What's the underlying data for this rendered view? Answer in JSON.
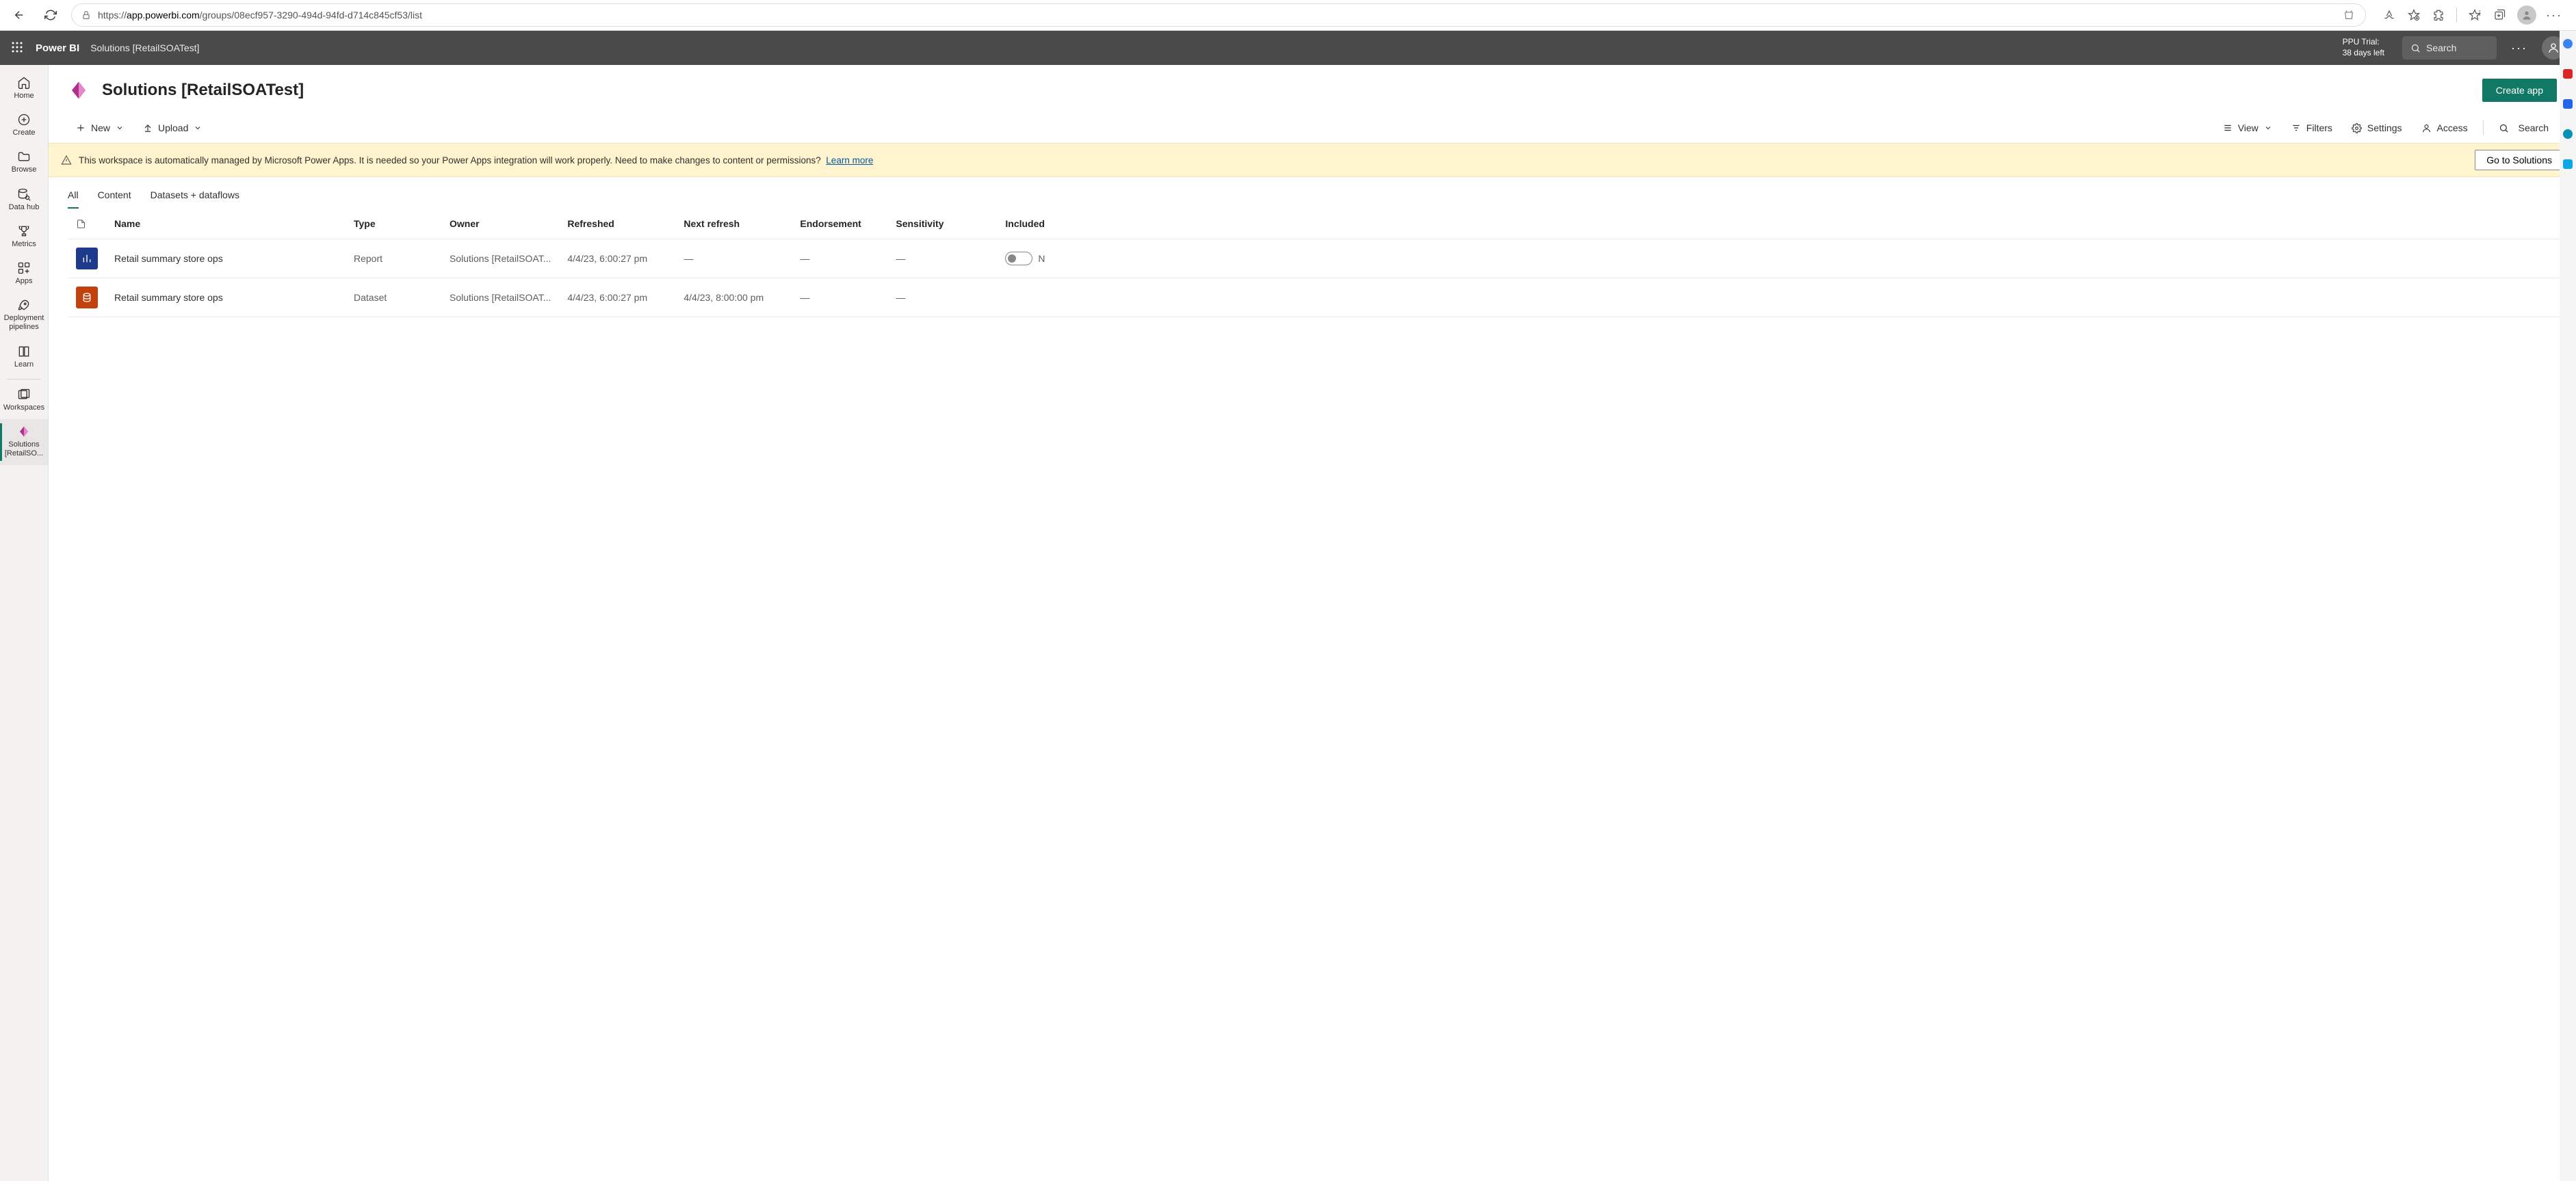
{
  "browser": {
    "url_prefix": "https://",
    "url_domain": "app.powerbi.com",
    "url_path": "/groups/08ecf957-3290-494d-94fd-d714c845cf53/list"
  },
  "appbar": {
    "brand": "Power BI",
    "context": "Solutions [RetailSOATest]",
    "trial_line1": "PPU Trial:",
    "trial_line2": "38 days left",
    "search_placeholder": "Search"
  },
  "leftnav": {
    "items": [
      {
        "label": "Home"
      },
      {
        "label": "Create"
      },
      {
        "label": "Browse"
      },
      {
        "label": "Data hub"
      },
      {
        "label": "Metrics"
      },
      {
        "label": "Apps"
      },
      {
        "label": "Deployment pipelines"
      },
      {
        "label": "Learn"
      },
      {
        "label": "Workspaces"
      }
    ],
    "current_ws": "Solutions [RetailSO..."
  },
  "page": {
    "title": "Solutions [RetailSOATest]",
    "create_app": "Create app"
  },
  "toolbar": {
    "new": "New",
    "upload": "Upload",
    "view": "View",
    "filters": "Filters",
    "settings": "Settings",
    "access": "Access",
    "search": "Search"
  },
  "banner": {
    "text": "This workspace is automatically managed by Microsoft Power Apps. It is needed so your Power Apps integration will work properly. Need to make changes to content or permissions?",
    "link": "Learn more",
    "button": "Go to Solutions"
  },
  "tabs": {
    "all": "All",
    "content": "Content",
    "datasets": "Datasets + dataflows"
  },
  "table": {
    "headers": {
      "name": "Name",
      "type": "Type",
      "owner": "Owner",
      "refreshed": "Refreshed",
      "next_refresh": "Next refresh",
      "endorsement": "Endorsement",
      "sensitivity": "Sensitivity",
      "included": "Included"
    },
    "rows": [
      {
        "icon_type": "report",
        "name": "Retail summary store ops",
        "type": "Report",
        "owner": "Solutions [RetailSOAT...",
        "refreshed": "4/4/23, 6:00:27 pm",
        "next_refresh": "—",
        "endorsement": "—",
        "sensitivity": "—",
        "included_toggle": true,
        "included_suffix": "N"
      },
      {
        "icon_type": "dataset",
        "name": "Retail summary store ops",
        "type": "Dataset",
        "owner": "Solutions [RetailSOAT...",
        "refreshed": "4/4/23, 6:00:27 pm",
        "next_refresh": "4/4/23, 8:00:00 pm",
        "endorsement": "—",
        "sensitivity": "—",
        "included_toggle": false,
        "included_suffix": ""
      }
    ]
  }
}
